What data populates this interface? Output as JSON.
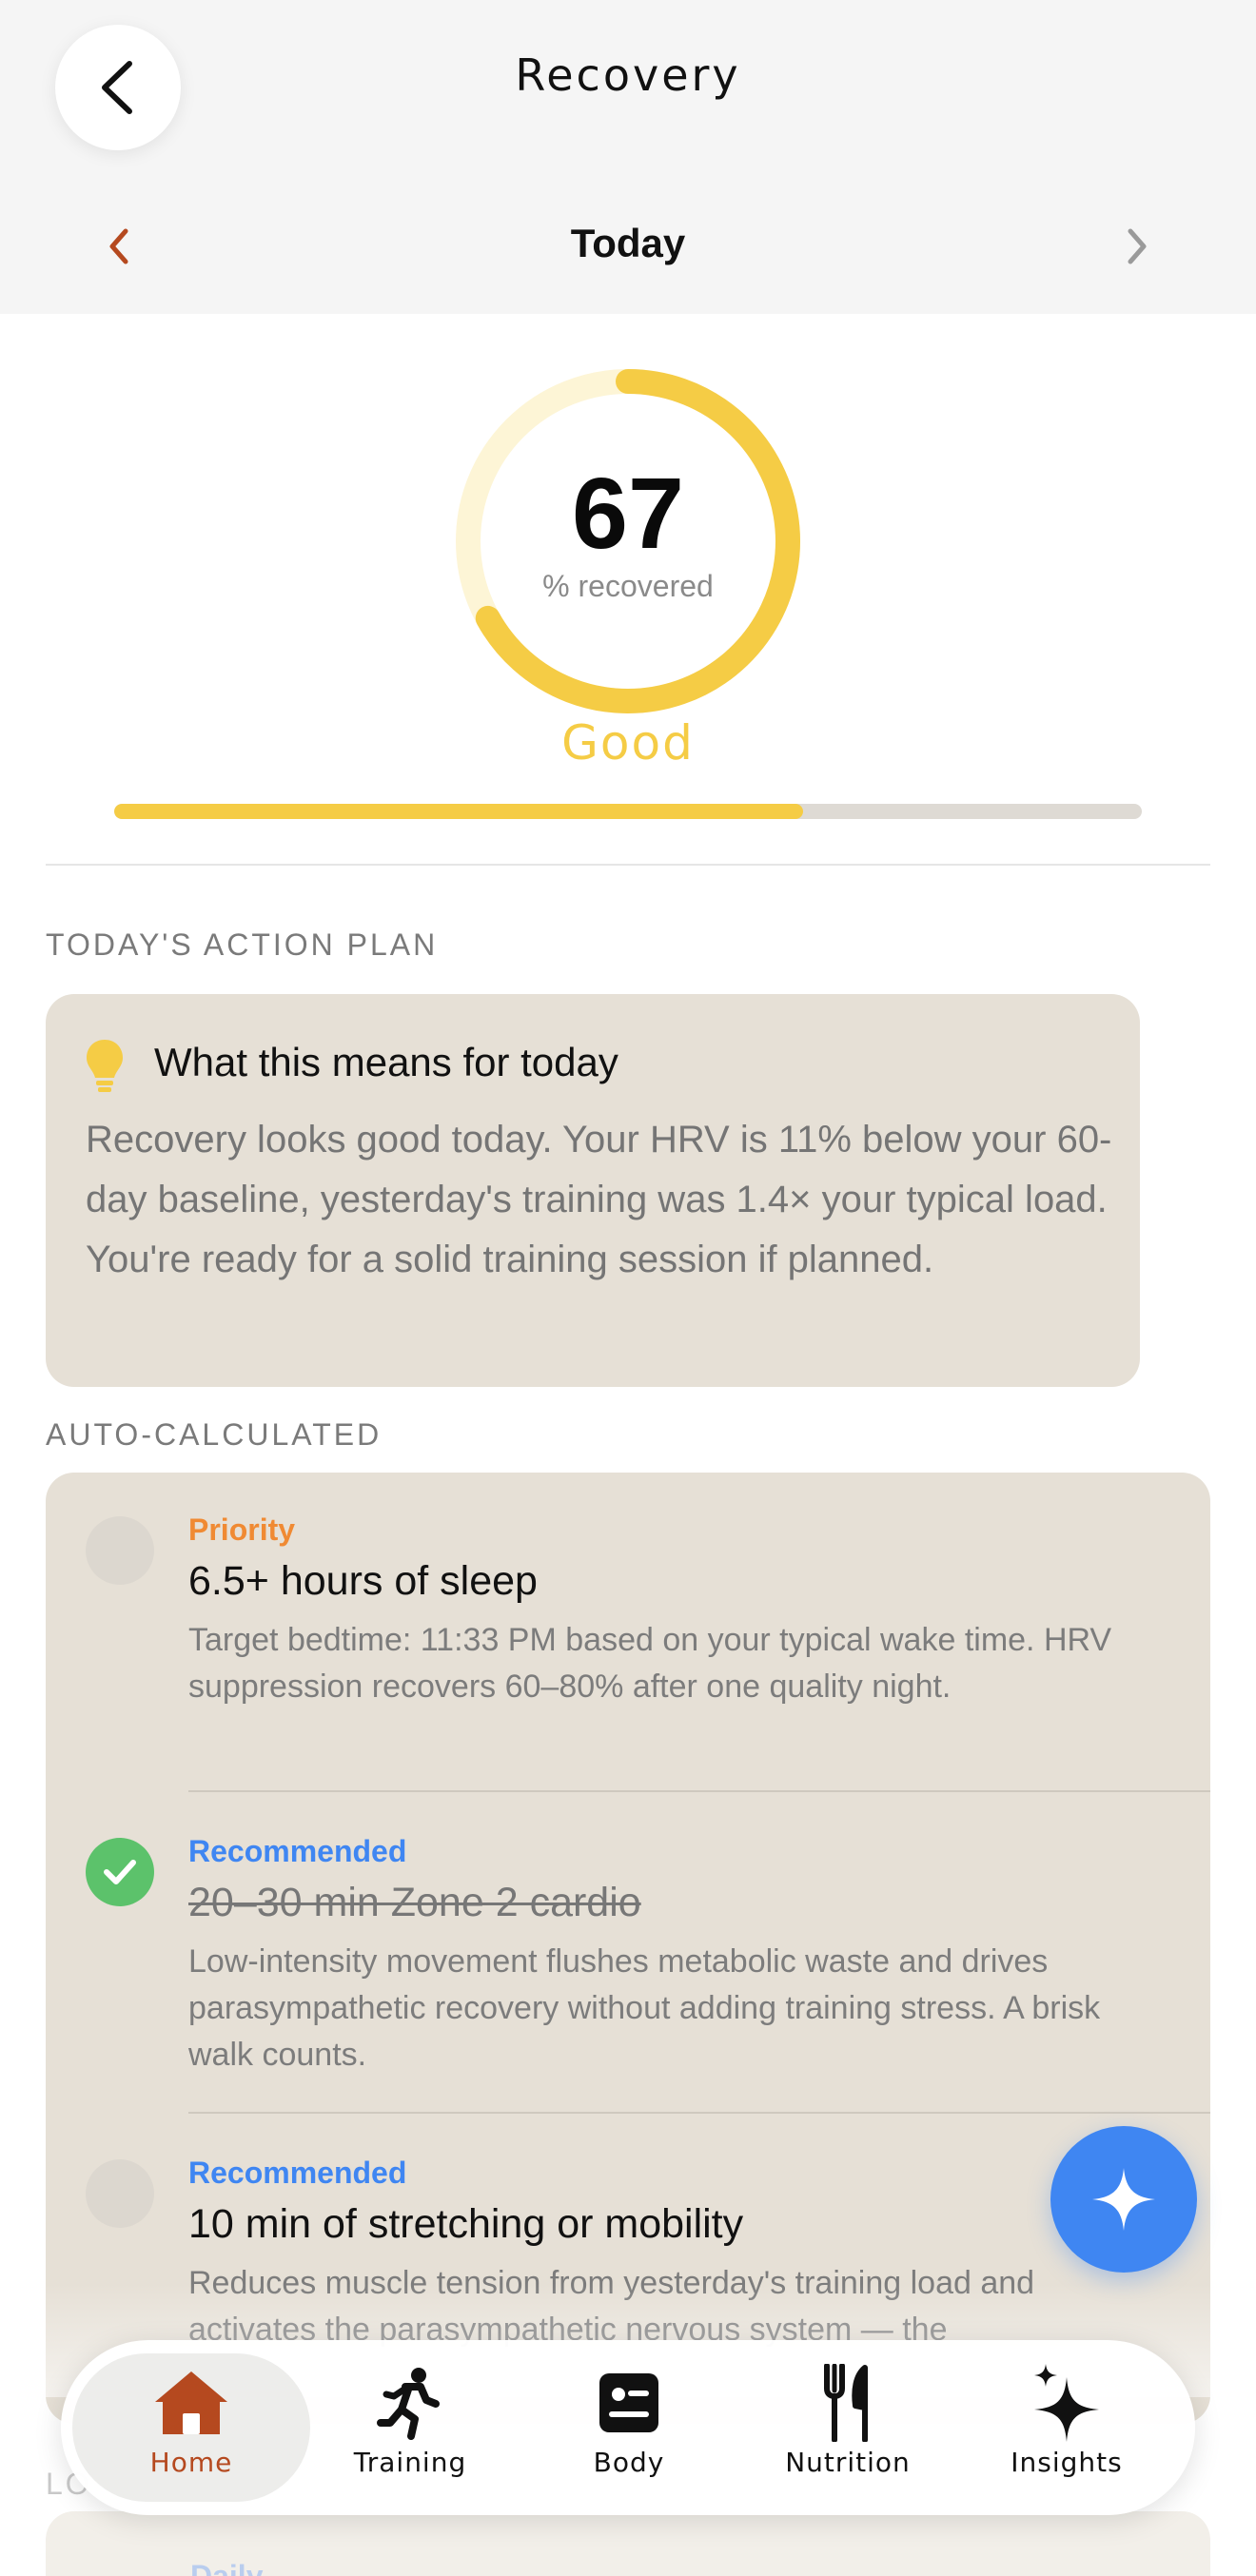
{
  "header": {
    "title": "Recovery",
    "date_label": "Today",
    "accent_color": "#b5491f"
  },
  "recovery": {
    "value": "67",
    "unit": "% recovered",
    "status": "Good",
    "fraction": 0.67,
    "color": "#f5cc45"
  },
  "action_plan": {
    "section_label": "TODAY'S ACTION PLAN",
    "card_title": "What this means for today",
    "card_body": "Recovery looks good today. Your HRV is 11% below your 60-day baseline, yesterday's training was 1.4× your typical load. You're ready for a solid training session if planned.",
    "icon": "lightbulb-icon"
  },
  "auto_calculated": {
    "section_label": "AUTO-CALCULATED",
    "items": [
      {
        "tag": "Priority",
        "tag_color": "#f08a33",
        "title": "6.5+ hours of sleep",
        "body": "Target bedtime: 11:33 PM based on your typical wake time. HRV suppression recovers 60–80% after one quality night.",
        "done": false
      },
      {
        "tag": "Recommended",
        "tag_color": "#3f86f2",
        "title": "20–30 min Zone 2 cardio",
        "body": "Low-intensity movement flushes metabolic waste and drives parasympathetic recovery without adding training stress. A brisk walk counts.",
        "done": true
      },
      {
        "tag": "Recommended",
        "tag_color": "#3f86f2",
        "title": "10 min of stretching or mobility",
        "body": "Reduces muscle tension from yesterday's training load and activates the parasympathetic nervous system — the",
        "done": false
      }
    ]
  },
  "below": {
    "section_label_partial": "LO",
    "sub_partial": "Daily"
  },
  "fab": {
    "icon": "sparkle-icon"
  },
  "tabbar": {
    "tabs": [
      {
        "label": "Home",
        "icon": "home-icon",
        "active": true
      },
      {
        "label": "Training",
        "icon": "running-icon",
        "active": false
      },
      {
        "label": "Body",
        "icon": "body-card-icon",
        "active": false
      },
      {
        "label": "Nutrition",
        "icon": "fork-knife-icon",
        "active": false
      },
      {
        "label": "Insights",
        "icon": "sparkles-icon",
        "active": false
      }
    ]
  }
}
